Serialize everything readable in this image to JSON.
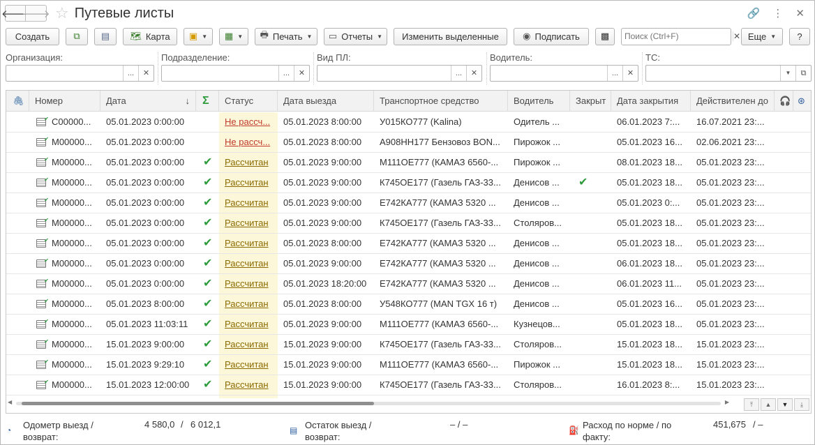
{
  "window": {
    "title": "Путевые листы"
  },
  "toolbar": {
    "create": "Создать",
    "map": "Карта",
    "print": "Печать",
    "reports": "Отчеты",
    "change_selected": "Изменить выделенные",
    "sign": "Подписать",
    "search_placeholder": "Поиск (Ctrl+F)",
    "more": "Еще",
    "help": "?"
  },
  "filters": {
    "organization": "Организация:",
    "division": "Подразделение:",
    "pl_type": "Вид ПЛ:",
    "driver": "Водитель:",
    "vehicle": "ТС:"
  },
  "columns": {
    "number": "Номер",
    "date": "Дата",
    "sum": "Σ",
    "status": "Статус",
    "departure": "Дата выезда",
    "vehicle": "Транспортное средство",
    "driver": "Водитель",
    "closed": "Закрыт",
    "close_date": "Дата закрытия",
    "valid_until": "Действителен до"
  },
  "rows": [
    {
      "number": "С00000...",
      "date": "05.01.2023 0:00:00",
      "sum": "",
      "status": "Не рассч...",
      "departure": "05.01.2023 8:00:00",
      "vehicle": "У015КО777 (Kalina)",
      "driver": "Одитель ...",
      "closed": "",
      "close_date": "06.01.2023 7:...",
      "valid_until": "16.07.2021 23:..."
    },
    {
      "number": "М00000...",
      "date": "05.01.2023 0:00:00",
      "sum": "",
      "status": "Не рассч...",
      "departure": "05.01.2023 8:00:00",
      "vehicle": "А908НН177 Бензовоз BON...",
      "driver": "Пирожок ...",
      "closed": "",
      "close_date": "05.01.2023 16...",
      "valid_until": "02.06.2021 23:..."
    },
    {
      "number": "М00000...",
      "date": "05.01.2023 0:00:00",
      "sum": "✔",
      "status": "Рассчитан",
      "departure": "05.01.2023 9:00:00",
      "vehicle": "М111ОЕ777 (КАМАЗ 6560-...",
      "driver": "Пирожок ...",
      "closed": "",
      "close_date": "08.01.2023 18...",
      "valid_until": "05.01.2023 23:..."
    },
    {
      "number": "М00000...",
      "date": "05.01.2023 0:00:00",
      "sum": "✔",
      "status": "Рассчитан",
      "departure": "05.01.2023 9:00:00",
      "vehicle": "К745ОЕ177 (Газель ГАЗ-33...",
      "driver": "Денисов ...",
      "closed": "✔",
      "close_date": "05.01.2023 18...",
      "valid_until": "05.01.2023 23:..."
    },
    {
      "number": "М00000...",
      "date": "05.01.2023 0:00:00",
      "sum": "✔",
      "status": "Рассчитан",
      "departure": "05.01.2023 9:00:00",
      "vehicle": "Е742КА777 (КАМАЗ 5320 ...",
      "driver": "Денисов ...",
      "closed": "",
      "close_date": "05.01.2023 0:...",
      "valid_until": "05.01.2023 23:..."
    },
    {
      "number": "М00000...",
      "date": "05.01.2023 0:00:00",
      "sum": "✔",
      "status": "Рассчитан",
      "departure": "05.01.2023 9:00:00",
      "vehicle": "К745ОЕ177 (Газель ГАЗ-33...",
      "driver": "Столяров...",
      "closed": "",
      "close_date": "05.01.2023 18...",
      "valid_until": "05.01.2023 23:..."
    },
    {
      "number": "М00000...",
      "date": "05.01.2023 0:00:00",
      "sum": "✔",
      "status": "Рассчитан",
      "departure": "05.01.2023 8:00:00",
      "vehicle": "Е742КА777 (КАМАЗ 5320 ...",
      "driver": "Денисов ...",
      "closed": "",
      "close_date": "05.01.2023 18...",
      "valid_until": "05.01.2023 23:..."
    },
    {
      "number": "М00000...",
      "date": "05.01.2023 0:00:00",
      "sum": "✔",
      "status": "Рассчитан",
      "departure": "05.01.2023 9:00:00",
      "vehicle": "Е742КА777 (КАМАЗ 5320 ...",
      "driver": "Денисов ...",
      "closed": "",
      "close_date": "06.01.2023 18...",
      "valid_until": "05.01.2023 23:..."
    },
    {
      "number": "М00000...",
      "date": "05.01.2023 0:00:00",
      "sum": "✔",
      "status": "Рассчитан",
      "departure": "05.01.2023 18:20:00",
      "vehicle": "Е742КА777 (КАМАЗ 5320 ...",
      "driver": "Денисов ...",
      "closed": "",
      "close_date": "06.01.2023 11...",
      "valid_until": "05.01.2023 23:..."
    },
    {
      "number": "М00000...",
      "date": "05.01.2023 8:00:00",
      "sum": "✔",
      "status": "Рассчитан",
      "departure": "05.01.2023 8:00:00",
      "vehicle": "У548КО777 (MAN TGX  16 т)",
      "driver": "Денисов ...",
      "closed": "",
      "close_date": "05.01.2023 16...",
      "valid_until": "05.01.2023 23:..."
    },
    {
      "number": "М00000...",
      "date": "05.01.2023 11:03:11",
      "sum": "✔",
      "status": "Рассчитан",
      "departure": "05.01.2023 9:00:00",
      "vehicle": "М111ОЕ777 (КАМАЗ 6560-...",
      "driver": "Кузнецов...",
      "closed": "",
      "close_date": "05.01.2023 18...",
      "valid_until": "05.01.2023 23:..."
    },
    {
      "number": "М00000...",
      "date": "15.01.2023 9:00:00",
      "sum": "✔",
      "status": "Рассчитан",
      "departure": "15.01.2023 9:00:00",
      "vehicle": "К745ОЕ177 (Газель ГАЗ-33...",
      "driver": "Столяров...",
      "closed": "",
      "close_date": "15.01.2023 18...",
      "valid_until": "15.01.2023 23:..."
    },
    {
      "number": "М00000...",
      "date": "15.01.2023 9:29:10",
      "sum": "✔",
      "status": "Рассчитан",
      "departure": "15.01.2023 9:00:00",
      "vehicle": "М111ОЕ777 (КАМАЗ 6560-...",
      "driver": "Пирожок ...",
      "closed": "",
      "close_date": "15.01.2023 18...",
      "valid_until": "15.01.2023 23:..."
    },
    {
      "number": "М00000...",
      "date": "15.01.2023 12:00:00",
      "sum": "✔",
      "status": "Рассчитан",
      "departure": "15.01.2023 9:00:00",
      "vehicle": "К745ОЕ177 (Газель ГАЗ-33...",
      "driver": "Столяров...",
      "closed": "",
      "close_date": "16.01.2023 8:...",
      "valid_until": "15.01.2023 23:..."
    }
  ],
  "footer": {
    "odometer_label_1": "Одометр выезд /",
    "odometer_label_2": "возврат:",
    "odometer_out": "4 580,0",
    "odometer_sep": "/",
    "odometer_in": "6 012,1",
    "rest_label_1": "Остаток выезд /",
    "rest_label_2": "возврат:",
    "rest_value": "–  /  –",
    "consumption_label_1": "Расход по норме / по",
    "consumption_label_2": "факту:",
    "consumption_norm": "451,675",
    "consumption_sep": "/  –"
  }
}
